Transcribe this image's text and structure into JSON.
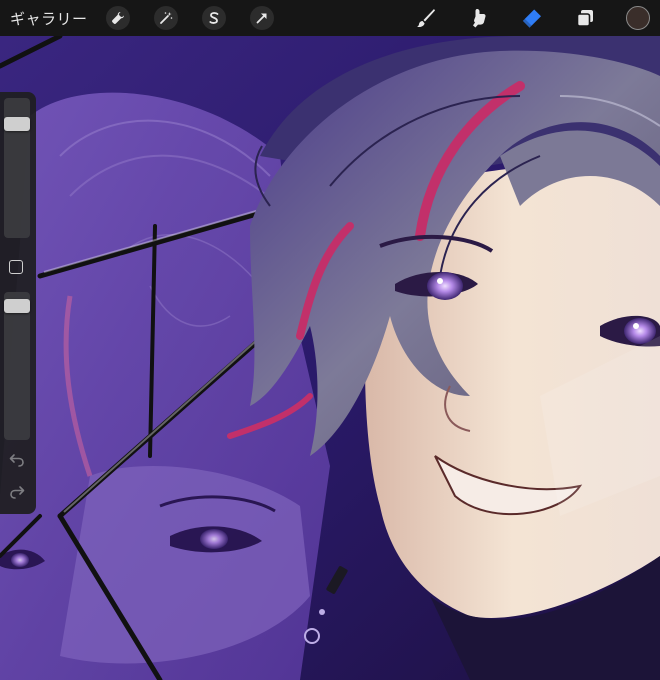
{
  "toolbar": {
    "gallery_label": "ギャラリー",
    "left_tools": [
      "wrench-icon",
      "magic-wand-icon",
      "selection-s-icon",
      "arrow-cursor-icon"
    ],
    "right_tools": [
      "brush-icon",
      "smudge-icon",
      "eraser-icon",
      "layers-icon"
    ],
    "active_tool": "eraser-icon",
    "active_color": "#3a2e2a",
    "accent_color": "#2f7df6"
  },
  "sidebar": {
    "size_slider": {
      "value": 0.85
    },
    "opacity_slider": {
      "value": 0.95
    },
    "buttons": [
      "modify-square-icon",
      "undo-icon",
      "redo-icon"
    ]
  },
  "canvas": {
    "palette": {
      "background": "#2a1860",
      "shadow": "#160b35",
      "hair": "#6c6a86",
      "hair_dark": "#3b3160",
      "highlight": "#c2306a",
      "skin": "#f0dfd0",
      "skin_shade": "#c9a9b8",
      "eye": "#9a6ad8",
      "reflection": "#6a4aa8"
    }
  }
}
